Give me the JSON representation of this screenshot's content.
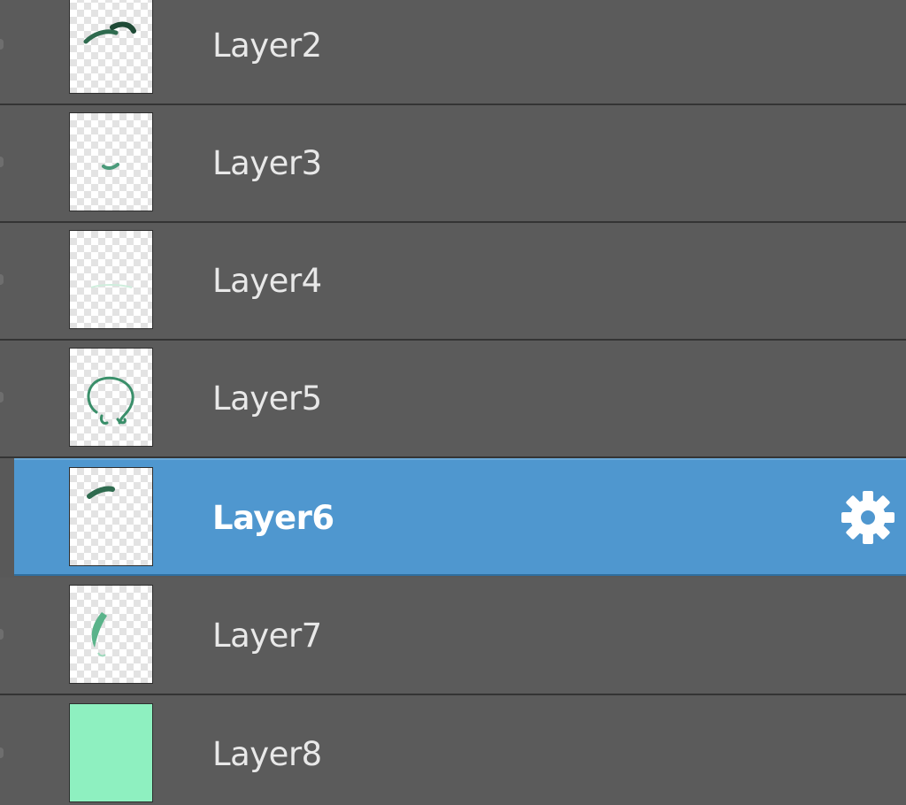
{
  "layers": [
    {
      "name": "Layer2",
      "selected": false,
      "thumbnail": "dark-green-stroke"
    },
    {
      "name": "Layer3",
      "selected": false,
      "thumbnail": "small-green-mark"
    },
    {
      "name": "Layer4",
      "selected": false,
      "thumbnail": "faint-light-mark"
    },
    {
      "name": "Layer5",
      "selected": false,
      "thumbnail": "green-outline-shape"
    },
    {
      "name": "Layer6",
      "selected": true,
      "thumbnail": "dark-green-stroke"
    },
    {
      "name": "Layer7",
      "selected": false,
      "thumbnail": "green-curve"
    },
    {
      "name": "Layer8",
      "selected": false,
      "thumbnail": "mint-fill"
    }
  ],
  "colors": {
    "panel_bg": "#5b5b5b",
    "selected_bg": "#4f97cf",
    "mint": "#8ef0c0",
    "stroke_green": "#2f6b4f"
  },
  "selected_row_icon": "gear-icon"
}
